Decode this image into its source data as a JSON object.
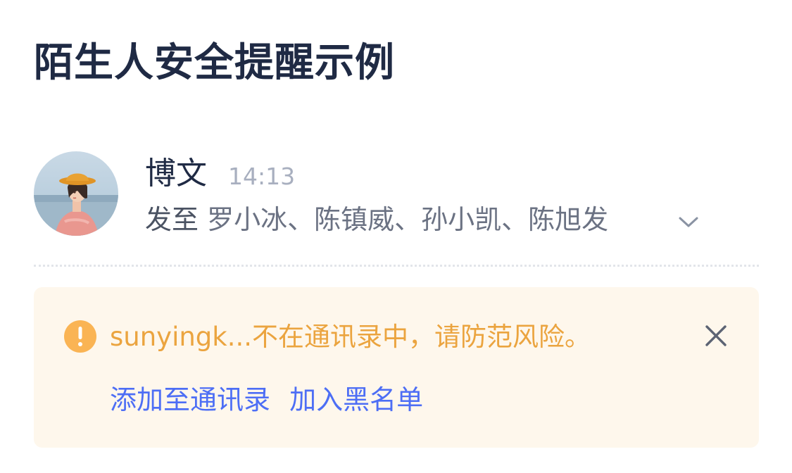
{
  "page": {
    "title": "陌生人安全提醒示例"
  },
  "message": {
    "sender_name": "博文",
    "time": "14:13",
    "recipients_prefix": "发至",
    "recipients": "罗小冰、陈镇威、孙小凯、陈旭发"
  },
  "alert": {
    "text": "sunyingk...不在通讯录中，请防范风险。",
    "actions": [
      {
        "label": "添加至通讯录"
      },
      {
        "label": "加入黑名单"
      }
    ]
  },
  "colors": {
    "title": "#1f2a44",
    "alert_bg": "#fef7ec",
    "warning": "#eba43f",
    "link": "#4d6ef5",
    "muted": "#a8afbf"
  },
  "icons": {
    "expand": "chevron-down-icon",
    "warning": "exclamation-circle-icon",
    "close": "close-icon"
  }
}
